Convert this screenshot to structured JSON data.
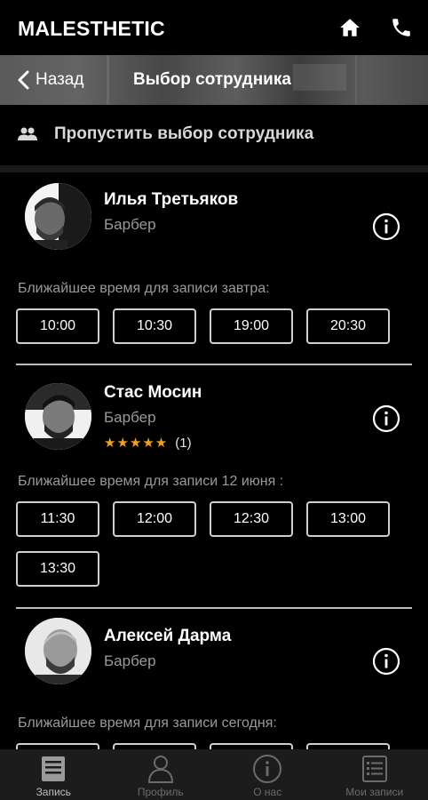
{
  "header": {
    "brand": "MALESTHETIC"
  },
  "nav": {
    "back_label": "Назад",
    "title": "Выбор сотрудника"
  },
  "skip": {
    "label": "Пропустить выбор сотрудника"
  },
  "staff": [
    {
      "name": "Илья Третьяков",
      "role": "Барбер",
      "slots_label": "Ближайшее время для записи завтра:",
      "slots": [
        "10:00",
        "10:30",
        "19:00",
        "20:30"
      ]
    },
    {
      "name": "Стас Мосин",
      "role": "Барбер",
      "rating_stars": 5,
      "rating_count": "(1)",
      "slots_label": "Ближайшее время для записи 12 июня :",
      "slots": [
        "11:30",
        "12:00",
        "12:30",
        "13:00",
        "13:30"
      ]
    },
    {
      "name": "Алексей Дарма",
      "role": "Барбер",
      "slots_label": "Ближайшее время для записи сегодня:"
    }
  ],
  "tabs": [
    {
      "label": "Запись",
      "icon": "booking-icon",
      "active": true
    },
    {
      "label": "Профиль",
      "icon": "profile-icon",
      "active": false
    },
    {
      "label": "О нас",
      "icon": "info-icon",
      "active": false
    },
    {
      "label": "Мои записи",
      "icon": "list-icon",
      "active": false
    }
  ],
  "colors": {
    "background": "#000000",
    "accent_star": "#f0a020",
    "muted_text": "#9a9a9a",
    "tabbar": "#1c1c1c"
  }
}
